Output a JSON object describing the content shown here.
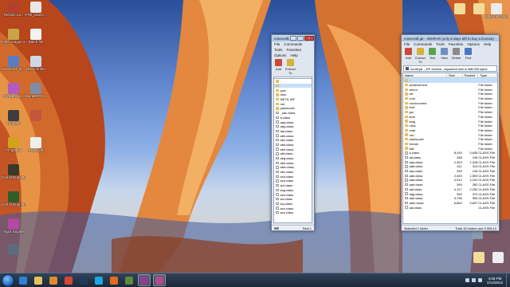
{
  "desktop_left": [
    {
      "label": "Technic La...",
      "color": "#b3402d"
    },
    {
      "label": "FTB_Launc...",
      "color": "#e8e8e8"
    },
    {
      "label": "Files League of Legends",
      "color": "#c9a446"
    },
    {
      "label": "Batch file",
      "color": "#f2f2f2"
    },
    {
      "label": "Survivors_B...",
      "color": "#5a7dc1"
    },
    {
      "label": "Recycle Bin",
      "color": "#cfd8e6"
    },
    {
      "label": "ToyMaryJ&...",
      "color": "#b05ac2"
    },
    {
      "label": "DivineRPG2...",
      "color": "#7f8ca3"
    },
    {
      "label": "Tonbash",
      "color": "#3d3d3d"
    },
    {
      "label": "",
      "color": "#c4563a"
    },
    {
      "label": "TT Math 3",
      "color": "#d1a21a"
    },
    {
      "label": "minecraft",
      "color": "#eeeeee"
    },
    {
      "label": "Call of Duty Modern...",
      "color": "#3a3a2a"
    },
    {
      "label": "Call of Duty Modern...",
      "color": "#2f5e2a"
    },
    {
      "label": "Agos Engine",
      "color": "#b349a1"
    },
    {
      "label": "",
      "color": "#5d6c7d"
    }
  ],
  "desktop_right": [
    {
      "label": "",
      "color": "#f1dc98"
    },
    {
      "label": "",
      "color": "#f1dc98"
    },
    {
      "label": "Minecraft random fea...",
      "color": "#ebebeb"
    },
    {
      "label": "",
      "color": "#8a9ab1"
    },
    {
      "label": "",
      "color": "#f1dc98"
    },
    {
      "label": "",
      "color": "#eeeeee"
    }
  ],
  "small_winrar": {
    "title": "minecraft.jar - WinRAR",
    "menu": [
      "File",
      "Commands"
    ],
    "menu2": [
      "Tools",
      "Favorites"
    ],
    "menu3": [
      "Options",
      "Help"
    ],
    "tools": [
      {
        "label": "Add",
        "color": "#c94a3a"
      },
      {
        "label": "Extract To",
        "color": "#d6b13e"
      }
    ],
    "path": "minecraft",
    "files": [
      {
        "name": "..",
        "type": "folder"
      },
      {
        "name": "",
        "type": "folder",
        "sel": true
      },
      {
        "name": "cpw",
        "type": "folder"
      },
      {
        "name": "dom",
        "type": "folder"
      },
      {
        "name": "META-INF",
        "type": "folder"
      },
      {
        "name": "net",
        "type": "folder"
      },
      {
        "name": "paulscode",
        "type": "folder"
      },
      {
        "name": "_aac.class",
        "type": "file"
      },
      {
        "name": "a.class",
        "type": "file"
      },
      {
        "name": "aaa.class",
        "type": "file"
      },
      {
        "name": "aaq.class",
        "type": "file"
      },
      {
        "name": "aar.class",
        "type": "file"
      },
      {
        "name": "abb.class",
        "type": "file"
      },
      {
        "name": "abc.class",
        "type": "file"
      },
      {
        "name": "abd.class",
        "type": "file"
      },
      {
        "name": "abe.class",
        "type": "file"
      },
      {
        "name": "abf.class",
        "type": "file"
      },
      {
        "name": "abg.class",
        "type": "file"
      },
      {
        "name": "abh.class",
        "type": "file"
      },
      {
        "name": "abw.class",
        "type": "file"
      },
      {
        "name": "abx.class",
        "type": "file"
      },
      {
        "name": "acd.class",
        "type": "file"
      },
      {
        "name": "ace.class",
        "type": "file"
      },
      {
        "name": "acf.class",
        "type": "file"
      },
      {
        "name": "acg.class",
        "type": "file"
      },
      {
        "name": "ach.class",
        "type": "file"
      },
      {
        "name": "aci.class",
        "type": "file"
      },
      {
        "name": "acj.class",
        "type": "file"
      },
      {
        "name": "acn.class",
        "type": "file"
      },
      {
        "name": "acs.class",
        "type": "file"
      }
    ],
    "status": "Total 1"
  },
  "big_winrar": {
    "title": "minecraft.jar - WinRAR (only 8 days left to buy a license)",
    "menu": [
      "File",
      "Commands",
      "Tools",
      "Favorites",
      "Options",
      "Help"
    ],
    "tools": [
      {
        "label": "Add",
        "color": "#c94a3a"
      },
      {
        "label": "Extract To",
        "color": "#d6b13e"
      },
      {
        "label": "Test",
        "color": "#5aa24f"
      },
      {
        "label": "View",
        "color": "#6f8fbf"
      },
      {
        "label": "Delete",
        "color": "#8a8a8a"
      },
      {
        "label": "Find",
        "color": "#4a77c2"
      }
    ],
    "path": "ecraft.jar - ZIP archive, unpacked size 8,968,055 bytes",
    "columns": [
      "Name",
      "Size",
      "Packed",
      "Type"
    ],
    "files": [
      {
        "name": "..",
        "size": "",
        "packed": "",
        "type": "",
        "kind": "folder"
      },
      {
        "name": "achievement",
        "size": "",
        "packed": "",
        "type": "File folder",
        "kind": "folder"
      },
      {
        "name": "armor",
        "size": "",
        "packed": "",
        "type": "File folder",
        "kind": "folder"
      },
      {
        "name": "art",
        "size": "",
        "packed": "",
        "type": "File folder",
        "kind": "folder"
      },
      {
        "name": "com",
        "size": "",
        "packed": "",
        "type": "File folder",
        "kind": "folder"
      },
      {
        "name": "environment",
        "size": "",
        "packed": "",
        "type": "File folder",
        "kind": "folder"
      },
      {
        "name": "font",
        "size": "",
        "packed": "",
        "type": "File folder",
        "kind": "folder"
      },
      {
        "name": "gui",
        "size": "",
        "packed": "",
        "type": "File folder",
        "kind": "folder"
      },
      {
        "name": "item",
        "size": "",
        "packed": "",
        "type": "File folder",
        "kind": "folder"
      },
      {
        "name": "lang",
        "size": "",
        "packed": "",
        "type": "File folder",
        "kind": "folder"
      },
      {
        "name": "misc",
        "size": "",
        "packed": "",
        "type": "File folder",
        "kind": "folder"
      },
      {
        "name": "mob",
        "size": "",
        "packed": "",
        "type": "File folder",
        "kind": "folder"
      },
      {
        "name": "net",
        "size": "",
        "packed": "",
        "type": "File folder",
        "kind": "folder"
      },
      {
        "name": "paulscode",
        "size": "",
        "packed": "",
        "type": "File folder",
        "kind": "folder"
      },
      {
        "name": "terrain",
        "size": "",
        "packed": "",
        "type": "File folder",
        "kind": "folder"
      },
      {
        "name": "title",
        "size": "",
        "packed": "",
        "type": "File folder",
        "kind": "folder"
      },
      {
        "name": "a.class",
        "size": "8,434",
        "packed": "3,635",
        "type": "CLASS File",
        "kind": "file"
      },
      {
        "name": "aa.class",
        "size": "288",
        "packed": "195",
        "type": "CLASS File",
        "kind": "file"
      },
      {
        "name": "aaa.class",
        "size": "2,303",
        "packed": "1,228",
        "type": "CLASS File",
        "kind": "file"
      },
      {
        "name": "aab.class",
        "size": "411",
        "packed": "313",
        "type": "CLASS File",
        "kind": "file"
      },
      {
        "name": "aac.class",
        "size": "339",
        "packed": "126",
        "type": "CLASS File",
        "kind": "file"
      },
      {
        "name": "aab.class",
        "size": "2,493",
        "packed": "1,503",
        "type": "CLASS File",
        "kind": "file"
      },
      {
        "name": "aad.class",
        "size": "4,012",
        "packed": "2,191",
        "type": "CLASS File",
        "kind": "file"
      },
      {
        "name": "aae.class",
        "size": "395",
        "packed": "282",
        "type": "CLASS File",
        "kind": "file"
      },
      {
        "name": "aaf.class",
        "size": "4,127",
        "packed": "2,254",
        "type": "CLASS File",
        "kind": "file"
      },
      {
        "name": "aag.class",
        "size": "459",
        "packed": "370",
        "type": "CLASS File",
        "kind": "file"
      },
      {
        "name": "aah.class",
        "size": "3,796",
        "packed": "953",
        "type": "CLASS File",
        "kind": "file"
      },
      {
        "name": "aam.class",
        "size": "6,862",
        "packed": "3,837",
        "type": "CLASS File",
        "kind": "file"
      },
      {
        "name": "aai.class",
        "size": "",
        "packed": "",
        "type": "CLASS File",
        "kind": "file"
      }
    ],
    "status_left": "Selected 1 folder",
    "status_right": "Total 15 folders and 3,008,10"
  },
  "taskbar": {
    "apps": [
      {
        "name": "ie",
        "color": "#2f7fd6"
      },
      {
        "name": "explorer",
        "color": "#e6c35a"
      },
      {
        "name": "media-player",
        "color": "#e08a2a"
      },
      {
        "name": "chrome",
        "color": "#d44638"
      },
      {
        "name": "steam",
        "color": "#233a5a"
      },
      {
        "name": "skype",
        "color": "#1ea6e8"
      },
      {
        "name": "firefox",
        "color": "#e66b1e"
      },
      {
        "name": "minecraft",
        "color": "#5b8a3a"
      },
      {
        "name": "winrar",
        "color": "#8f3f8f",
        "active": true
      },
      {
        "name": "winrar-2",
        "color": "#b14e8a",
        "active": true
      }
    ],
    "time": "4:08 PM",
    "date": "2/13/2013"
  }
}
